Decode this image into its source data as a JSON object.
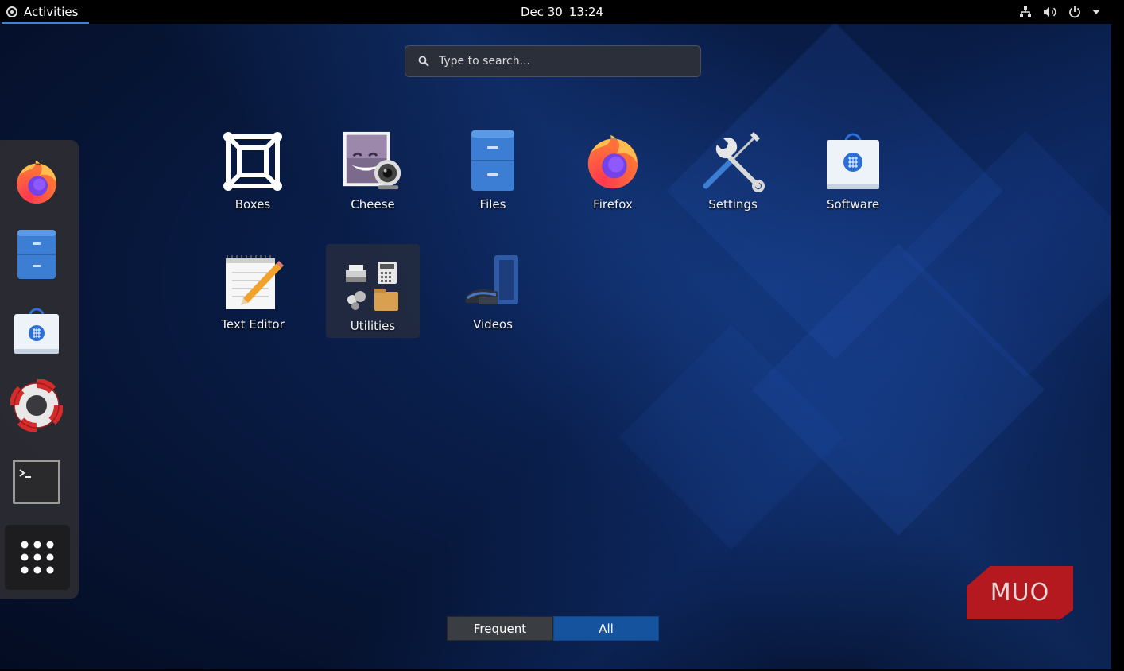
{
  "topbar": {
    "activities_label": "Activities",
    "date": "Dec 30",
    "time": "13:24",
    "tray_icons": [
      "network-icon",
      "volume-icon",
      "power-icon",
      "menu-arrow-icon"
    ]
  },
  "search": {
    "placeholder": "Type to search..."
  },
  "dock": {
    "items": [
      {
        "name": "Firefox",
        "icon": "firefox-icon"
      },
      {
        "name": "Files",
        "icon": "files-icon"
      },
      {
        "name": "Software",
        "icon": "software-icon"
      },
      {
        "name": "Help",
        "icon": "help-icon"
      },
      {
        "name": "Terminal",
        "icon": "terminal-icon"
      }
    ],
    "show_apps_icon": "show-applications-icon"
  },
  "apps": [
    {
      "label": "Boxes",
      "icon": "boxes-icon"
    },
    {
      "label": "Cheese",
      "icon": "cheese-icon"
    },
    {
      "label": "Files",
      "icon": "files-icon"
    },
    {
      "label": "Firefox",
      "icon": "firefox-icon"
    },
    {
      "label": "Settings",
      "icon": "settings-icon"
    },
    {
      "label": "Software",
      "icon": "software-icon"
    },
    {
      "label": "Text Editor",
      "icon": "text-editor-icon"
    },
    {
      "label": "Utilities",
      "icon": "utilities-folder-icon"
    },
    {
      "label": "Videos",
      "icon": "videos-icon"
    }
  ],
  "tabs": [
    {
      "label": "Frequent",
      "active": false
    },
    {
      "label": "All",
      "active": true
    }
  ],
  "watermark": "MUO",
  "colors": {
    "accent": "#15539e",
    "focus_underline": "#3584e4",
    "watermark_red": "#b3191f"
  }
}
